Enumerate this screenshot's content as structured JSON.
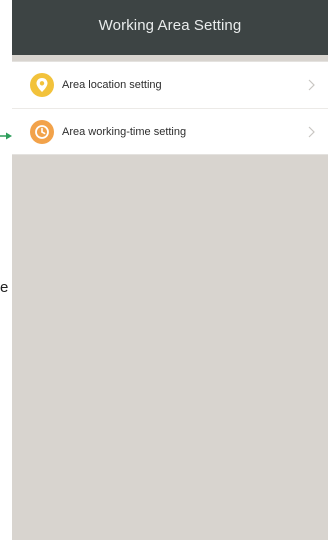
{
  "header": {
    "title": "Working Area Setting"
  },
  "menu": {
    "items": [
      {
        "label": "Area location setting",
        "icon": "location-pin-icon",
        "color": "#f2c23b"
      },
      {
        "label": "Area working-time setting",
        "icon": "clock-icon",
        "color": "#f2a24a"
      }
    ]
  },
  "edge": {
    "stray_text": "e",
    "arrow_color": "#2e9e5b"
  }
}
